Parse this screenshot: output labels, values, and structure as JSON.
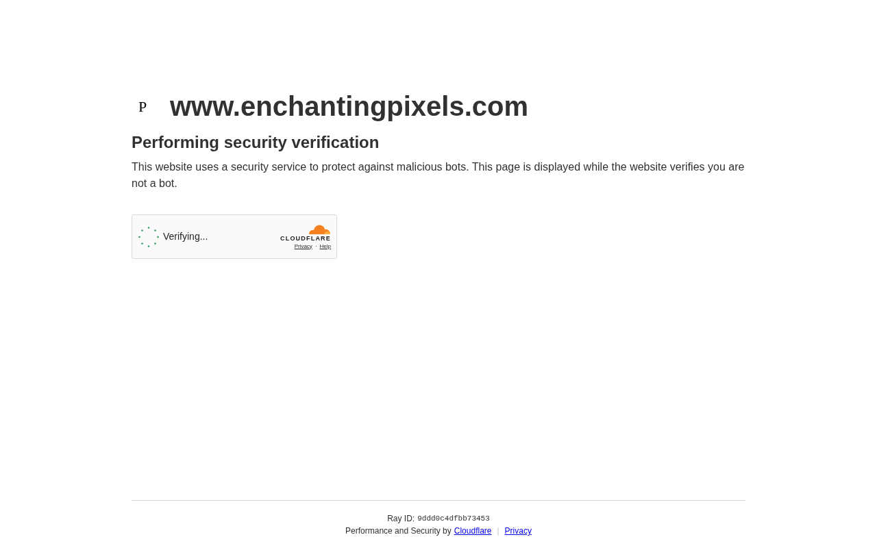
{
  "site": {
    "favicon": "P",
    "domain": "www.enchantingpixels.com"
  },
  "heading": "Performing security verification",
  "description": "This website uses a security service to protect against malicious bots. This page is displayed while the website verifies you are not a bot.",
  "widget": {
    "status": "Verifying...",
    "brand": "CLOUDFLARE",
    "links": [
      "Privacy",
      "Help"
    ],
    "separator": "·"
  },
  "footer": {
    "ray_label": "Ray ID:",
    "ray_id": "9ddd0c4dfbb73453",
    "credit": "Performance and Security by",
    "credit_link": "Cloudflare",
    "separator": "|",
    "privacy": "Privacy"
  }
}
